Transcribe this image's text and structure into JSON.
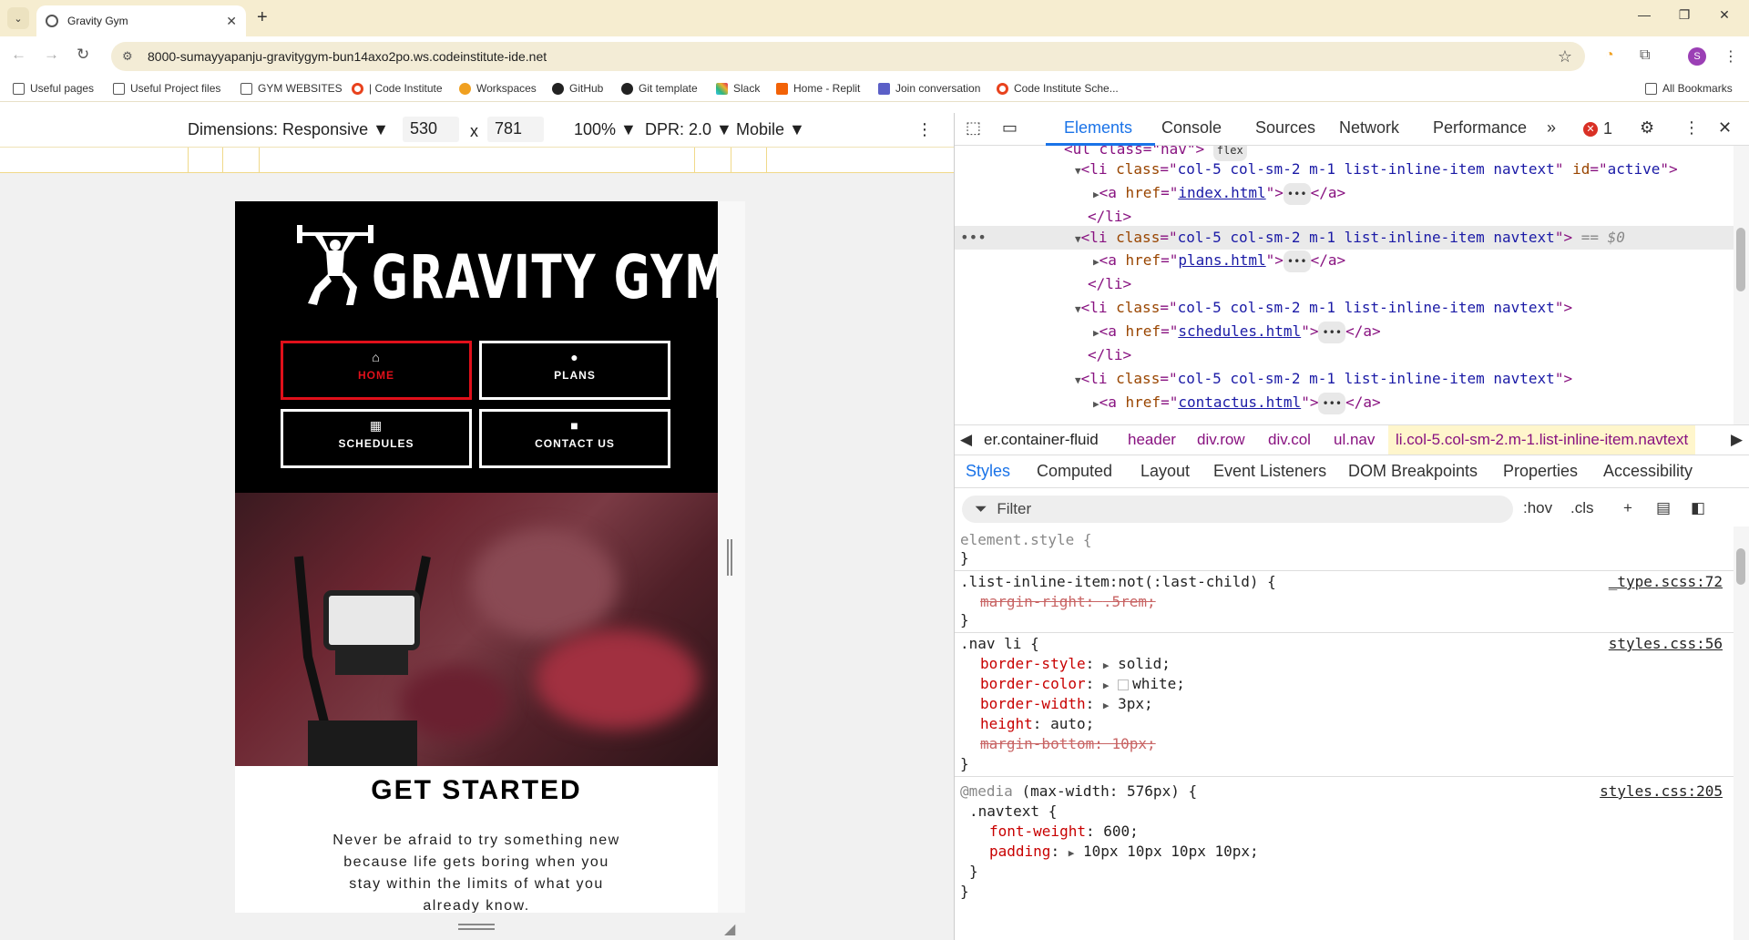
{
  "browser": {
    "tab_title": "Gravity Gym",
    "url": "8000-sumayyapanju-gravitygym-bun14axo2po.ws.codeinstitute-ide.net",
    "profile_initial": "S",
    "bookmarks": [
      "Useful pages",
      "Useful Project files",
      "GYM WEBSITES",
      "| Code Institute",
      "Workspaces",
      "GitHub",
      "Git template",
      "Slack",
      "Home - Replit",
      "Join conversation",
      "Code Institute Sche..."
    ],
    "all_bookmarks": "All Bookmarks"
  },
  "device_toolbar": {
    "dimensions": "Dimensions: Responsive ▼",
    "width": "530",
    "times": "x",
    "height": "781",
    "zoom": "100% ▼",
    "dpr": "DPR: 2.0 ▼",
    "mode": "Mobile ▼"
  },
  "site": {
    "title": "GRAVITY GYM",
    "nav": [
      "HOME",
      "PLANS",
      "SCHEDULES",
      "CONTACT US"
    ],
    "get_started": "GET STARTED",
    "intro": "Never be afraid to try something new because life gets boring when you stay within the limits of what you already know."
  },
  "devtools": {
    "tabs": [
      "Elements",
      "Console",
      "Sources",
      "Network",
      "Performance"
    ],
    "more": "»",
    "error_count": "1",
    "dom": {
      "ul_line": "<ul class=\"nav\">",
      "flex_badge": "flex",
      "li_active_class": "col-5 col-sm-2 m-1 list-inline-item navtext",
      "li_active_id": "active",
      "li_class": "col-5 col-sm-2 m-1 list-inline-item navtext",
      "hrefs": [
        "index.html",
        "plans.html",
        "schedules.html",
        "contactus.html"
      ],
      "selected_marker": "== $0",
      "li_close": "</li>",
      "a_close": "</a>",
      "dots": "•••"
    },
    "breadcrumbs": [
      "er.container-fluid",
      "header",
      "div.row",
      "div.col",
      "ul.nav",
      "li.col-5.col-sm-2.m-1.list-inline-item.navtext"
    ],
    "subtabs": [
      "Styles",
      "Computed",
      "Layout",
      "Event Listeners",
      "DOM Breakpoints",
      "Properties",
      "Accessibility"
    ],
    "filter_placeholder": "Filter",
    "hov": ":hov",
    "cls": ".cls",
    "rules": {
      "element_style": "element.style {",
      "r1_selector": ".list-inline-item:not(:last-child) {",
      "r1_source": "_type.scss:72",
      "r1_prop": "margin-right",
      "r1_val": ".5rem;",
      "r2_selector": ".nav li {",
      "r2_source": "styles.css:56",
      "r2_props": [
        {
          "p": "border-style",
          "v": "solid;"
        },
        {
          "p": "border-color",
          "v": "white;"
        },
        {
          "p": "border-width",
          "v": "3px;"
        },
        {
          "p": "height",
          "v": "auto;"
        },
        {
          "p": "margin-bottom",
          "v": "10px;"
        }
      ],
      "media": "@media",
      "media_query": "(max-width: 576px) {",
      "r3_source": "styles.css:205",
      "r3_selector": ".navtext {",
      "r3_props": [
        {
          "p": "font-weight",
          "v": "600;"
        },
        {
          "p": "padding",
          "v": "10px 10px 10px 10px;"
        }
      ],
      "close": "}"
    }
  }
}
